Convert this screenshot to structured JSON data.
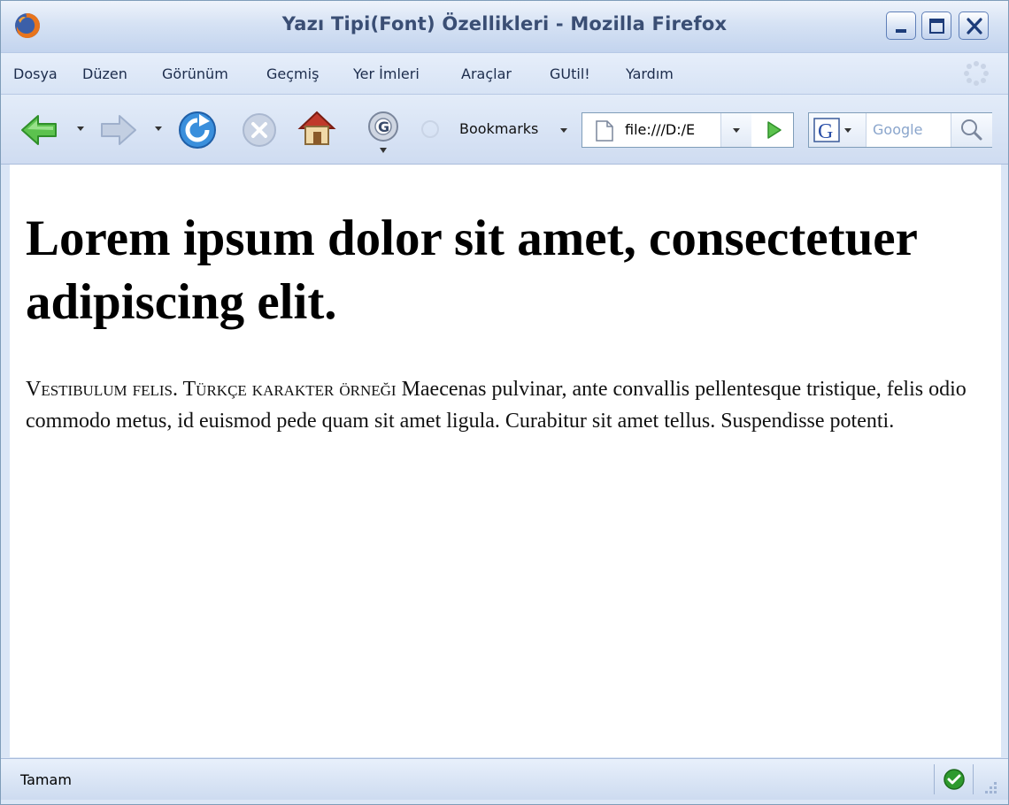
{
  "window": {
    "title": "Yazı Tipi(Font) Özellikleri - Mozilla Firefox"
  },
  "menu": {
    "items": [
      {
        "label": "Dosya"
      },
      {
        "label": "Düzen"
      },
      {
        "label": "Görünüm"
      },
      {
        "label": "Geçmiş"
      },
      {
        "label": "Yer İmleri"
      },
      {
        "label": "Araçlar"
      },
      {
        "label": "GUtil!"
      },
      {
        "label": "Yardım"
      }
    ]
  },
  "toolbar": {
    "bookmarks_label": "Bookmarks",
    "address": "file:///D:/E",
    "search_placeholder": "Google",
    "icons": [
      "back-icon",
      "forward-icon",
      "reload-icon",
      "stop-icon",
      "home-icon",
      "google-toolbar-icon",
      "page-icon",
      "go-icon",
      "google-engine-icon",
      "magnifier-icon"
    ]
  },
  "page": {
    "heading": "Lorem ipsum dolor sit amet, consectetuer adipiscing elit.",
    "paragraph_smallcaps": "Vestibulum felis. Türkçe karakter örneği",
    "paragraph_rest": " Maecenas pulvinar, ante convallis pellentesque tristique, felis odio commodo metus, id euismod pede quam sit amet ligula. Curabitur sit amet tellus. Suspendisse potenti."
  },
  "status": {
    "text": "Tamam"
  },
  "colors": {
    "chrome_blue": "#dbe6f6",
    "title_text": "#3a4e74",
    "ok_green": "#2e9a2e"
  }
}
